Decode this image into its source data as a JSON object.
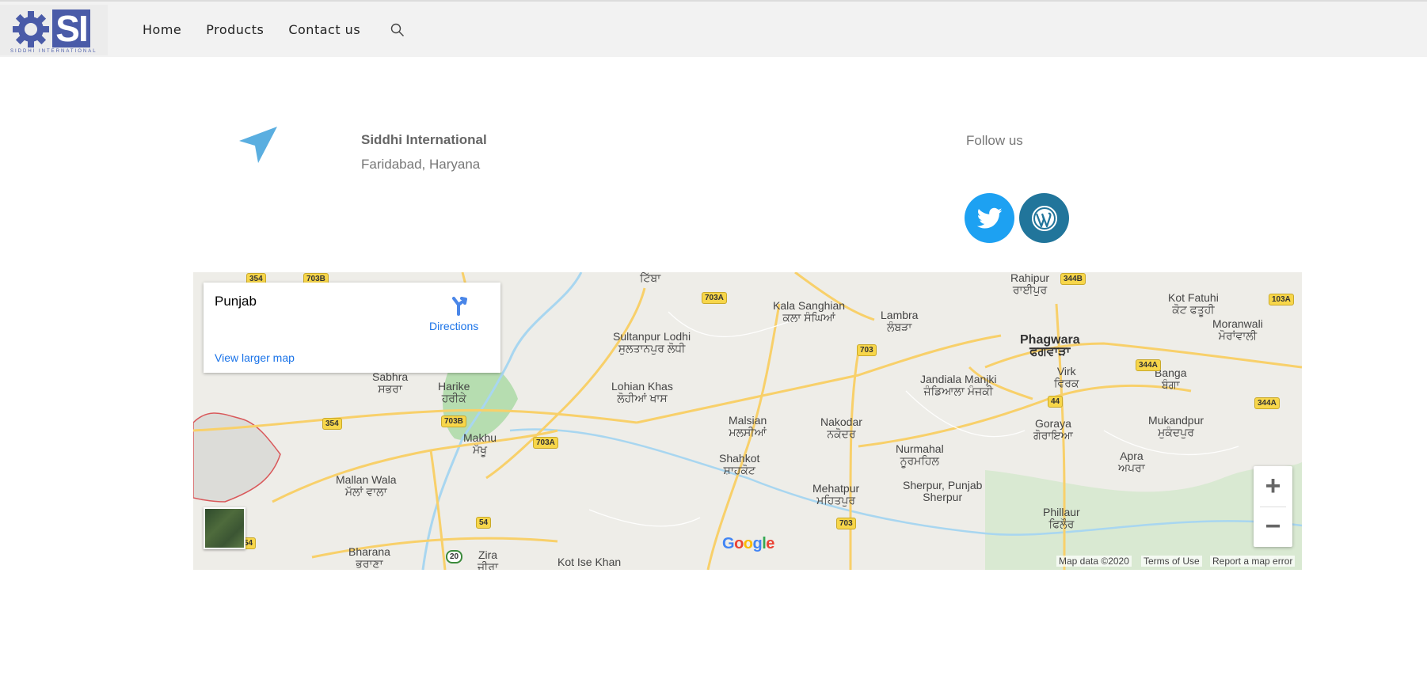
{
  "header": {
    "logo_letters": "SI",
    "logo_text": "SIDDHI INTERNATIONAL",
    "nav": [
      "Home",
      "Products",
      "Contact us"
    ]
  },
  "contact": {
    "company": "Siddhi International",
    "address": "Faridabad, Haryana",
    "follow_label": "Follow us"
  },
  "map": {
    "info_title": "Punjab",
    "directions_label": "Directions",
    "larger_map_label": "View larger map",
    "zoom_in": "+",
    "zoom_out": "−",
    "google_logo": "Google",
    "attribution": {
      "map_data": "Map data ©2020",
      "terms": "Terms of Use",
      "report": "Report a map error"
    },
    "places": [
      {
        "name": "Kala Sanghian",
        "alt": "ਕਲਾ ਸੰਘਿਆਂ"
      },
      {
        "name": "Lambra",
        "alt": "ਲੰਬੜਾ"
      },
      {
        "name": "Phagwara",
        "alt": "ਫਗਵਾੜਾ"
      },
      {
        "name": "Kot Fatuhi",
        "alt": "ਕੋਟ ਫਤੂਹੀ"
      },
      {
        "name": "Moranwali",
        "alt": "ਮੋਰਾਂਵਾਲੀ"
      },
      {
        "name": "Sultanpur Lodhi",
        "alt": "ਸੁਲਤਾਨਪੁਰ ਲੋਧੀ"
      },
      {
        "name": "Lohian Khas",
        "alt": "ਲੋਹੀਆਂ ਖਾਸ"
      },
      {
        "name": "Harike",
        "alt": "ਹਰੀਕੇ"
      },
      {
        "name": "Sabhra",
        "alt": "ਸਭਰਾ"
      },
      {
        "name": "Makhu",
        "alt": "ਮੱਖੂ"
      },
      {
        "name": "Malsian",
        "alt": "ਮਲਸੀਆਂ"
      },
      {
        "name": "Nakodar",
        "alt": "ਨਕੋਦਰ"
      },
      {
        "name": "Jandiala Manjki",
        "alt": "ਜੰਡਿਆਲਾ ਮੰਜਕੀ"
      },
      {
        "name": "Virk",
        "alt": "ਵਿਰਕ"
      },
      {
        "name": "Banga",
        "alt": "ਬੰਗਾ"
      },
      {
        "name": "Goraya",
        "alt": "ਗੋਰਾਇਆ"
      },
      {
        "name": "Mukandpur",
        "alt": "ਮੁਕੰਦਪੁਰ"
      },
      {
        "name": "Shahkot",
        "alt": "ਸ਼ਾਹਕੋਟ"
      },
      {
        "name": "Nurmahal",
        "alt": "ਨੂਰਮਹਿਲ"
      },
      {
        "name": "Apra",
        "alt": "ਅਪਰਾ"
      },
      {
        "name": "Mallan Wala",
        "alt": "ਮੱਲਾਂ ਵਾਲਾ"
      },
      {
        "name": "Mehatpur",
        "alt": "ਮਹਿਤਪੁਰ"
      },
      {
        "name": "Sherpur, Punjab",
        "alt": "Sherpur"
      },
      {
        "name": "Phillaur",
        "alt": "ਫਿਲੌਰ"
      },
      {
        "name": "Bharana",
        "alt": "ਭਰਾਣਾ"
      },
      {
        "name": "Zira",
        "alt": "ਜ਼ੀਰਾ"
      },
      {
        "name": "Kot Ise Khan",
        "alt": ""
      },
      {
        "name": "Rahipur",
        "alt": "ਰਾਈਪੁਰ"
      },
      {
        "name": "ਟਿੱਬਾ",
        "alt": ""
      }
    ],
    "shields": [
      "354",
      "703B",
      "703A",
      "703",
      "344B",
      "103A",
      "344A",
      "44",
      "344A",
      "354",
      "703B",
      "703A",
      "54",
      "20",
      "703",
      "54"
    ]
  }
}
